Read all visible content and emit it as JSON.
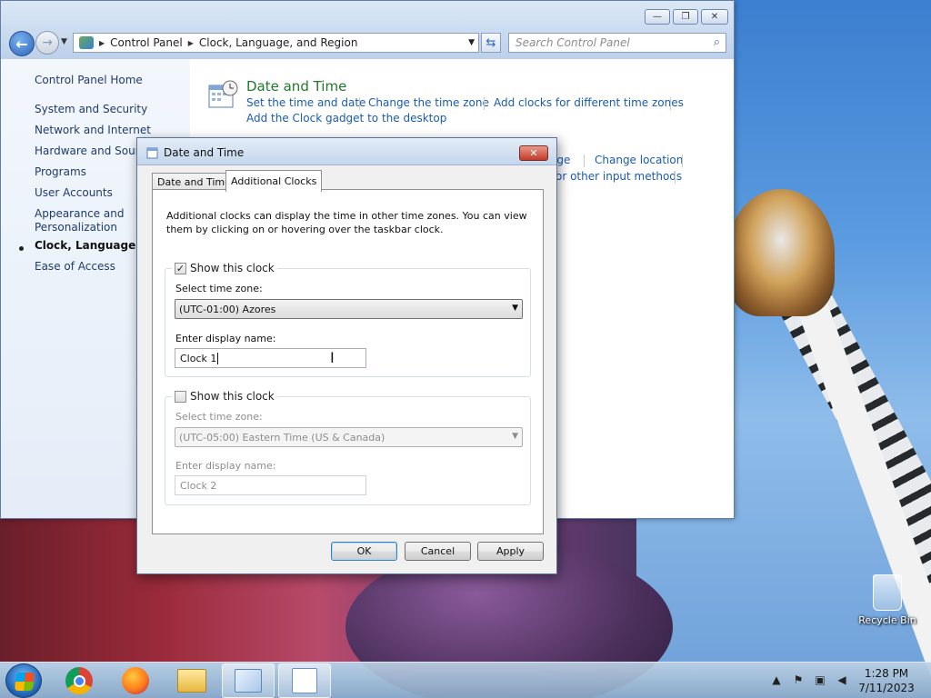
{
  "window": {
    "breadcrumb": [
      "Control Panel",
      "Clock, Language, and Region"
    ],
    "search_placeholder": "Search Control Panel"
  },
  "sidebar": {
    "home": "Control Panel Home",
    "items": [
      {
        "label": "System and Security"
      },
      {
        "label": "Network and Internet"
      },
      {
        "label": "Hardware and Sound"
      },
      {
        "label": "Programs"
      },
      {
        "label": "User Accounts"
      },
      {
        "label": "Appearance and\nPersonalization"
      },
      {
        "label": "Clock, Language, and Region",
        "active": true
      },
      {
        "label": "Ease of Access"
      }
    ]
  },
  "main": {
    "category_title": "Date and Time",
    "links": [
      "Set the time and date",
      "Change the time zone",
      "Add clocks for different time zones",
      "Add the Clock gadget to the desktop"
    ],
    "obscured_links": [
      "age",
      "Change location",
      "or other input methods"
    ]
  },
  "dialog": {
    "title": "Date and Time",
    "tabs": [
      "Date and Time",
      "Additional Clocks"
    ],
    "active_tab": "Additional Clocks",
    "description": "Additional clocks can display the time in other time zones. You can view them by clicking on or hovering over the taskbar clock.",
    "clock1": {
      "show_label": "Show this clock",
      "checked": true,
      "tz_label": "Select time zone:",
      "tz_value": "(UTC-01:00) Azores",
      "name_label": "Enter display name:",
      "name_value": "Clock 1"
    },
    "clock2": {
      "show_label": "Show this clock",
      "checked": false,
      "tz_label": "Select time zone:",
      "tz_value": "(UTC-05:00) Eastern Time (US & Canada)",
      "name_label": "Enter display name:",
      "name_value": "Clock 2"
    },
    "buttons": {
      "ok": "OK",
      "cancel": "Cancel",
      "apply": "Apply"
    }
  },
  "desktop": {
    "recycle_bin": "Recycle Bin"
  },
  "taskbar": {
    "time": "1:28 PM",
    "date": "7/11/2023"
  }
}
